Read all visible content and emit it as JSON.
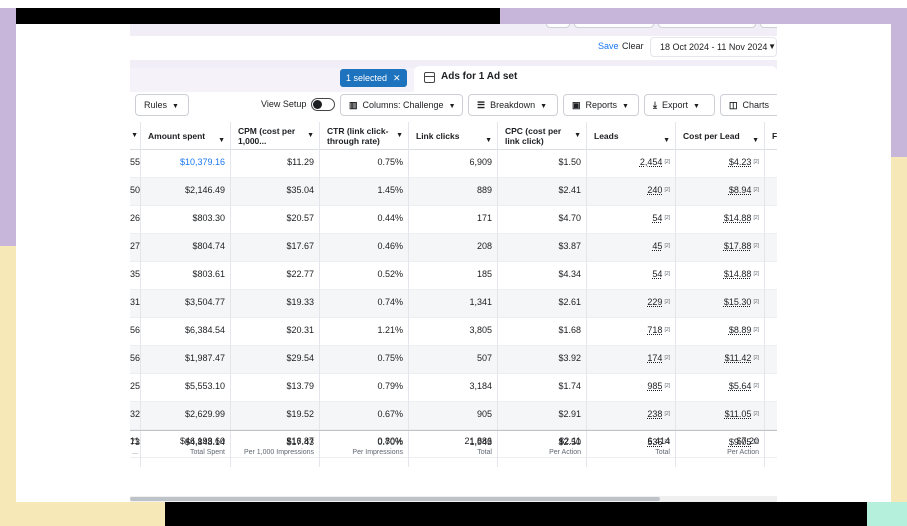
{
  "header": {
    "save_label": "Save",
    "clear_label": "Clear",
    "date_range": "18 Oct 2024 - 11 Nov 2024"
  },
  "tabs": {
    "selected_chip": "1 selected",
    "ads_tab_label": "Ads for 1 Ad set"
  },
  "toolbar": {
    "rules_label": "Rules",
    "view_setup_label": "View Setup",
    "columns_label": "Columns: Challenge",
    "breakdown_label": "Breakdown",
    "reports_label": "Reports",
    "export_label": "Export",
    "charts_label": "Charts"
  },
  "table": {
    "columns": [
      {
        "label": ""
      },
      {
        "label": "Amount spent"
      },
      {
        "label": "CPM (cost per 1,000..."
      },
      {
        "label": "CTR (link click-through rate)"
      },
      {
        "label": "Link clicks"
      },
      {
        "label": "CPC (cost per link click)"
      },
      {
        "label": "Leads"
      },
      {
        "label": "Cost per Lead"
      },
      {
        "label": "F"
      }
    ],
    "rows": [
      {
        "c0": "55",
        "amount": "$10,379.16",
        "cpm": "$11.29",
        "ctr": "0.75%",
        "clicks": "6,909",
        "cpc": "$1.50",
        "leads": "2,454",
        "cpl": "$4.23"
      },
      {
        "c0": "50",
        "amount": "$2,146.49",
        "cpm": "$35.04",
        "ctr": "1.45%",
        "clicks": "889",
        "cpc": "$2.41",
        "leads": "240",
        "cpl": "$8.94"
      },
      {
        "c0": "26",
        "amount": "$803.30",
        "cpm": "$20.57",
        "ctr": "0.44%",
        "clicks": "171",
        "cpc": "$4.70",
        "leads": "54",
        "cpl": "$14.88"
      },
      {
        "c0": "27",
        "amount": "$804.74",
        "cpm": "$17.67",
        "ctr": "0.46%",
        "clicks": "208",
        "cpc": "$3.87",
        "leads": "45",
        "cpl": "$17.88"
      },
      {
        "c0": "35",
        "amount": "$803.61",
        "cpm": "$22.77",
        "ctr": "0.52%",
        "clicks": "185",
        "cpc": "$4.34",
        "leads": "54",
        "cpl": "$14.88"
      },
      {
        "c0": "31",
        "amount": "$3,504.77",
        "cpm": "$19.33",
        "ctr": "0.74%",
        "clicks": "1,341",
        "cpc": "$2.61",
        "leads": "229",
        "cpl": "$15.30"
      },
      {
        "c0": "56",
        "amount": "$6,384.54",
        "cpm": "$20.31",
        "ctr": "1.21%",
        "clicks": "3,805",
        "cpc": "$1.68",
        "leads": "718",
        "cpl": "$8.89"
      },
      {
        "c0": "56",
        "amount": "$1,987.47",
        "cpm": "$29.54",
        "ctr": "0.75%",
        "clicks": "507",
        "cpc": "$3.92",
        "leads": "174",
        "cpl": "$11.42"
      },
      {
        "c0": "25",
        "amount": "$5,553.10",
        "cpm": "$13.79",
        "ctr": "0.79%",
        "clicks": "3,184",
        "cpc": "$1.74",
        "leads": "985",
        "cpl": "$5.64"
      },
      {
        "c0": "32",
        "amount": "$2,629.99",
        "cpm": "$19.52",
        "ctr": "0.67%",
        "clicks": "905",
        "cpc": "$2.91",
        "leads": "238",
        "cpl": "$11.05"
      },
      {
        "c0": "73",
        "amount": "$4,848.14",
        "cpm": "$17.43",
        "ctr": "0.70%",
        "clicks": "1,943",
        "cpc": "$2.50",
        "leads": "536",
        "cpl": "$9.05"
      }
    ],
    "totals": {
      "c0": "11",
      "c0_sub": "...",
      "amount": "$46,193.60",
      "amount_sub": "Total Spent",
      "cpm": "$16.87",
      "cpm_sub": "Per 1,000 Impressions",
      "ctr": "0.80%",
      "ctr_sub": "Per Impressions",
      "clicks": "21,886",
      "clicks_sub": "Total",
      "cpc": "$2.11",
      "cpc_sub": "Per Action",
      "leads": "6,414",
      "leads_sub": "Total",
      "cpl": "$7.20",
      "cpl_sub": "Per Action"
    }
  },
  "icons": {
    "sort": "sort-caret-icon",
    "info": "info-superscript-icon",
    "calendar": "calendar-icon",
    "columns": "columns-icon",
    "breakdown": "breakdown-icon",
    "reports": "reports-icon",
    "export": "export-icon",
    "charts": "charts-icon"
  },
  "colors": {
    "accent_link": "#1877f2",
    "chip_bg": "#1e73be",
    "frame_purple": "#c8b6da",
    "frame_yellow": "#f7e8b8",
    "frame_teal": "#b5f0dc"
  }
}
